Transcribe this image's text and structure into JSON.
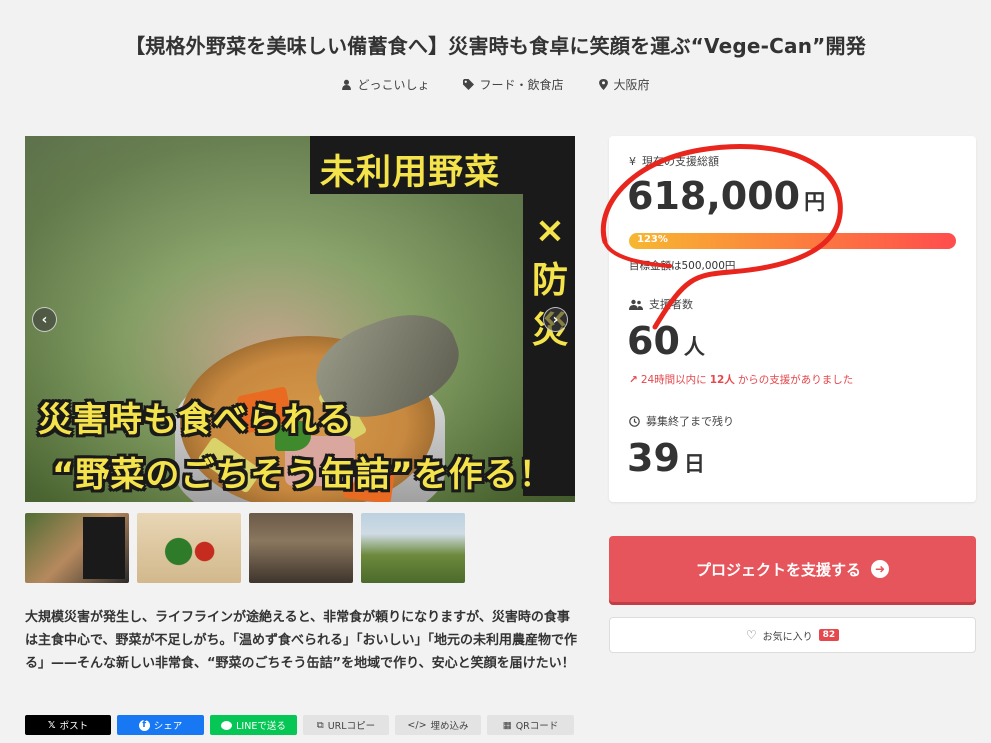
{
  "project": {
    "title": "【規格外野菜を美味しい備蓄食へ】災害時も食卓に笑顔を運ぶ“Vege-Can”開発",
    "author": "どっこいしょ",
    "category": "フード・飲食店",
    "location": "大阪府"
  },
  "hero": {
    "banner_top": "未利用野菜",
    "banner_side": "×防災",
    "caption_line1": "災害時も食べられる",
    "caption_line2": "“野菜のごちそう缶詰”を作る！",
    "prev_icon": "‹",
    "next_icon": "›"
  },
  "thumbnails": [
    {
      "name": "thumb-can"
    },
    {
      "name": "thumb-vegetables"
    },
    {
      "name": "thumb-chefs"
    },
    {
      "name": "thumb-farm-group"
    }
  ],
  "description": "大規模災害が発生し、ライフラインが途絶えると、非常食が頼りになりますが、災害時の食事は主食中心で、野菜が不足しがち。「温めず食べられる」「おいしい」「地元の未利用農産物で作る」——そんな新しい非常食、“野菜のごちそう缶詰”を地域で作り、安心と笑顔を届けたい！",
  "share": {
    "x": "ポスト",
    "facebook": "シェア",
    "line": "LINEで送る",
    "url": "URLコピー",
    "embed": "埋め込み",
    "qr": "QRコード"
  },
  "stats": {
    "amount_label": "現在の支援総額",
    "amount": "618,000",
    "amount_unit": "円",
    "progress_percent": "123%",
    "progress_value": 1.23,
    "goal": "目標金額は500,000円",
    "backers_label": "支援者数",
    "backers": "60",
    "backers_unit": "人",
    "trend_prefix": "24時間以内に",
    "trend_count": "12人",
    "trend_suffix": "からの支援がありました",
    "remaining_label": "募集終了まで残り",
    "remaining": "39",
    "remaining_unit": "日"
  },
  "actions": {
    "support": "プロジェクトを支援する",
    "favorite": "お気に入り",
    "favorite_count": "82"
  },
  "colors": {
    "accent": "#e7555c",
    "annotation": "#e8261d",
    "banner_text": "#f4e34a"
  }
}
